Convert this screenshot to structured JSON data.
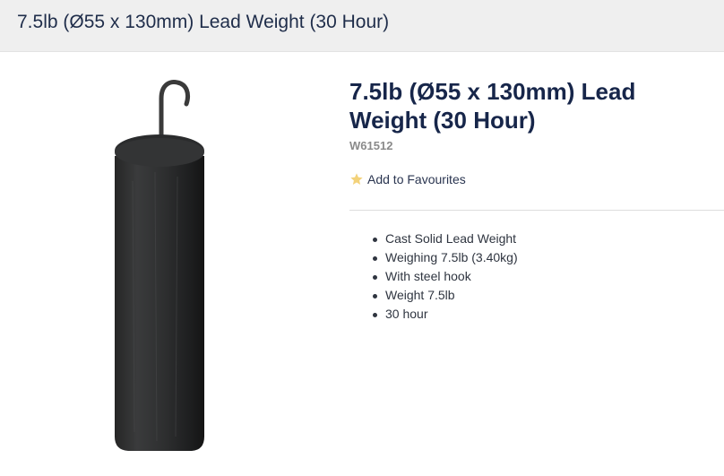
{
  "header": {
    "title": "7.5lb (Ø55 x 130mm) Lead Weight (30 Hour)"
  },
  "product": {
    "title": "7.5lb (Ø55 x 130mm) Lead Weight (30 Hour)",
    "sku": "W61512",
    "favourite_label": "Add to Favourites",
    "favourite_icon": "star-icon",
    "features": [
      "Cast Solid Lead Weight",
      "Weighing 7.5lb (3.40kg)",
      "With steel hook",
      "Weight 7.5lb",
      "30 hour"
    ]
  },
  "colors": {
    "title": "#17264a",
    "header_bg": "#efefef",
    "star": "#f3d27a"
  }
}
